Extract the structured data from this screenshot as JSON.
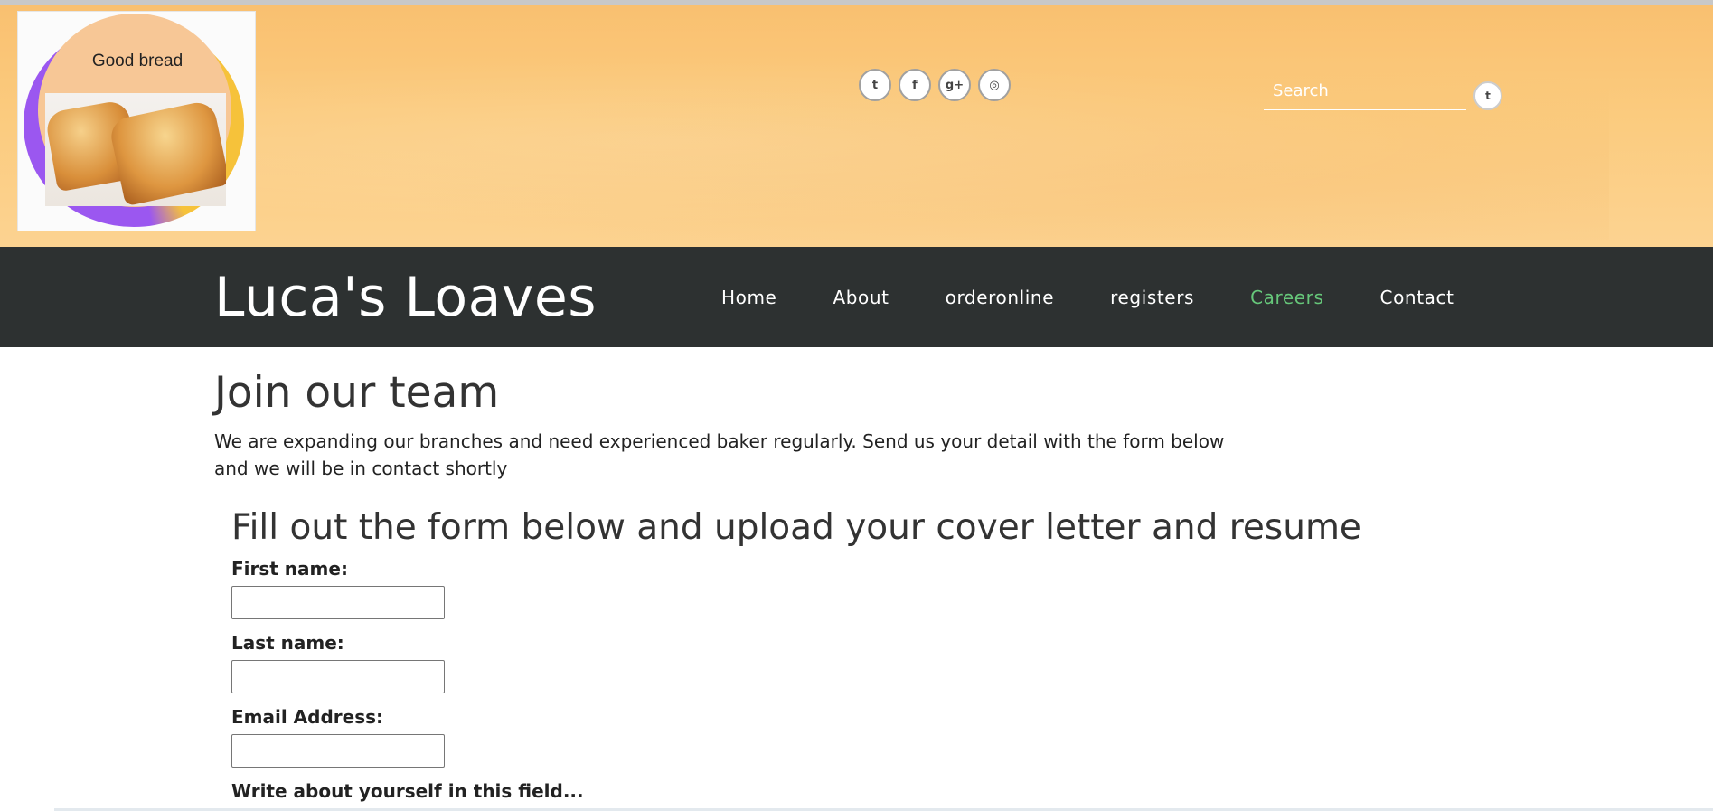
{
  "header": {
    "logo_text": "Good bread",
    "social_icons": [
      {
        "name": "twitter-icon",
        "glyph": "t"
      },
      {
        "name": "facebook-icon",
        "glyph": "f"
      },
      {
        "name": "google-plus-icon",
        "glyph": "g+"
      },
      {
        "name": "dribbble-icon",
        "glyph": "◎"
      }
    ],
    "search": {
      "placeholder": "Search",
      "value": "",
      "button_icon": "twitter-icon",
      "button_glyph": "t"
    }
  },
  "nav": {
    "site_title": "Luca's Loaves",
    "links": [
      "Home",
      "About",
      "orderonline",
      "registers",
      "Careers",
      "Contact"
    ],
    "active_link": "Careers",
    "active_color": "#66c77a",
    "bar_color": "#2d3131"
  },
  "main": {
    "heading": "Join our team",
    "intro": "We are expanding our branches and need experienced baker regularly. Send us your detail with the form below and we will be in contact shortly",
    "form": {
      "heading": "Fill out the form below and upload your cover letter and resume",
      "first_name_label": "First name:",
      "first_name_value": "",
      "last_name_label": "Last name:",
      "last_name_value": "",
      "email_label": "Email Address:",
      "email_value": "",
      "about_label": "Write about yourself in this field...",
      "about_value": ""
    }
  }
}
